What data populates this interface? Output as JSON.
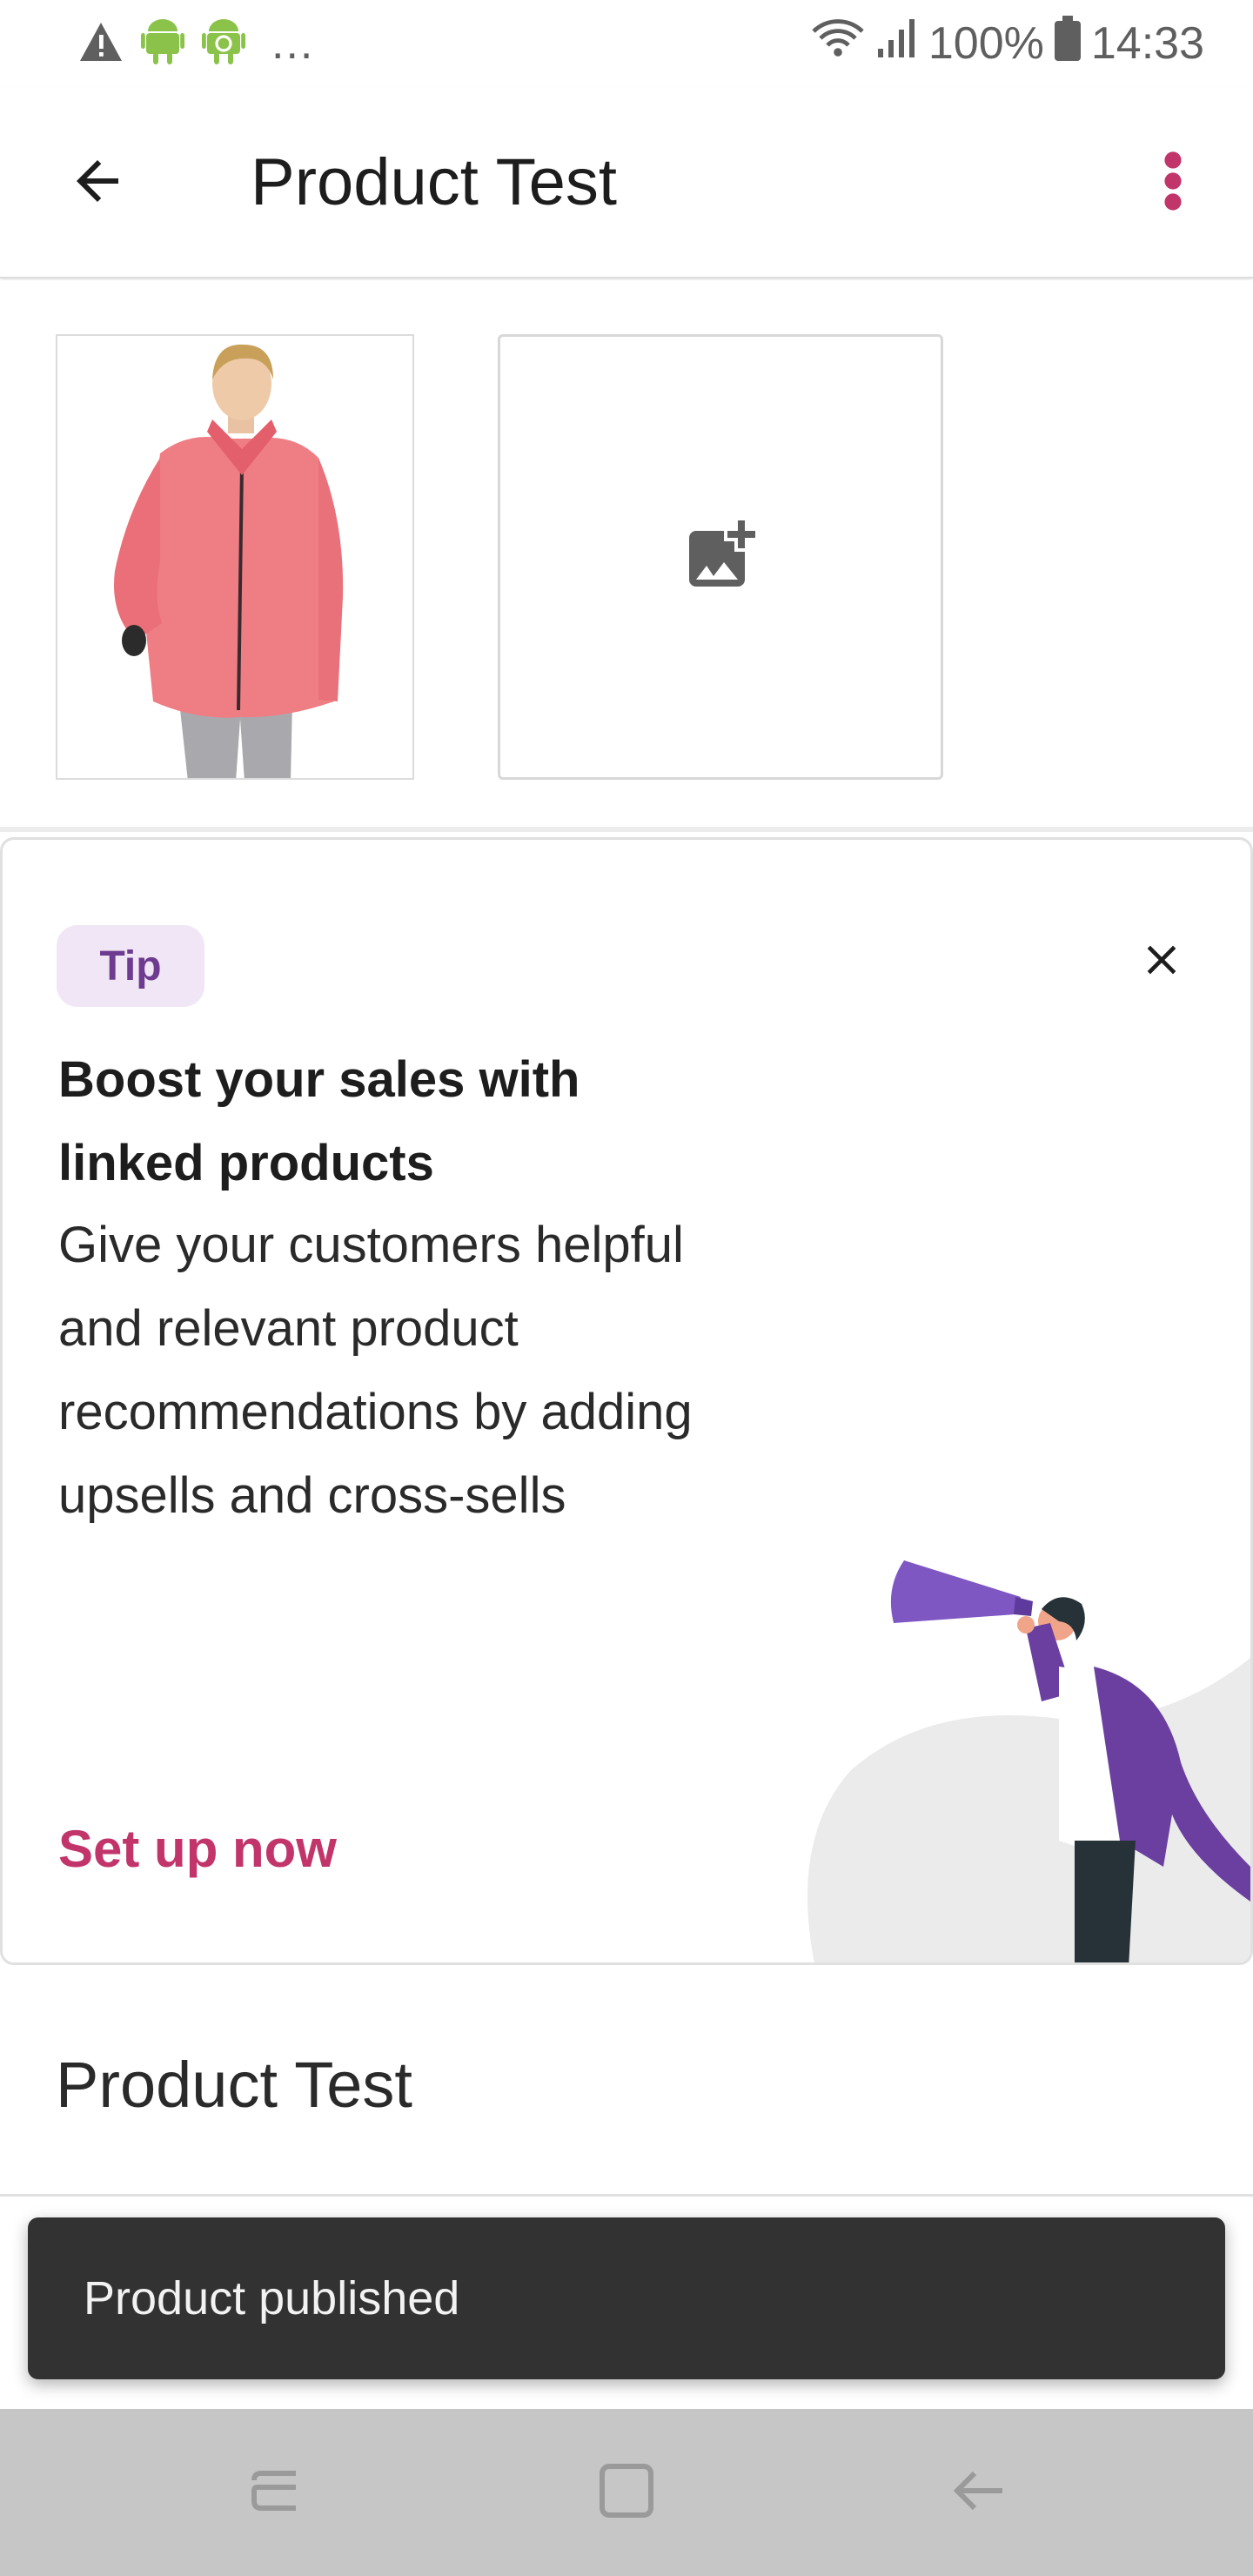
{
  "status_bar": {
    "battery": "100%",
    "time": "14:33",
    "more": "..."
  },
  "app_bar": {
    "title": "Product Test",
    "back_icon": "arrow-back-icon",
    "menu_icon": "more-vert-icon",
    "accent_color": "#c2356b"
  },
  "images": {
    "product_image_alt": "pink jacket product photo",
    "add_image_icon": "add-photo-icon"
  },
  "tip_card": {
    "badge": "Tip",
    "title": "Boost your sales with linked products",
    "body": "Give your customers helpful and relevant product recommendations by adding upsells and cross-sells",
    "cta": "Set up now",
    "close_icon": "close-icon",
    "badge_bg": "#f1e6f5",
    "badge_color": "#6d3b8f"
  },
  "product": {
    "name": "Product Test"
  },
  "snackbar": {
    "message": "Product published"
  },
  "nav_bar": {
    "recents_icon": "recents-icon",
    "home_icon": "home-icon",
    "back_icon": "nav-back-icon"
  }
}
